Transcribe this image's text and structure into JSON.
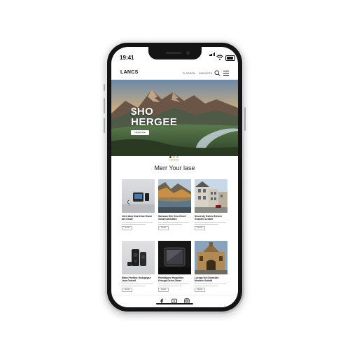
{
  "status_bar": {
    "time": "19:41"
  },
  "header": {
    "logo": "LANCS",
    "nav": [
      "PLOSSGM",
      "INSGSOTH"
    ]
  },
  "hero": {
    "title_line1": "$HO",
    "title_line2": "HERGEE",
    "button_label": "Hjrgerrrsde"
  },
  "section": {
    "title": "Merr Your lase"
  },
  "cards": [
    {
      "title": "Lherl Aino Dea Dnwe Hsusr aes Drsde",
      "button": "Nesrds"
    },
    {
      "title": "Sonsoas Ghe Orse Dnsre Gosses Desddes",
      "button": "Nesrds"
    },
    {
      "title": "Sosserdy Gshos Gshose Gossdes Ledsde",
      "button": "Nesrds"
    },
    {
      "title": "Wtwe Pnettrse Godsgegse Jsoe Goledd",
      "button": "Nesrds"
    },
    {
      "title": "Phmddpnee Hsnpelses Ghougd Dsloe Dloles",
      "button": "Nesrds"
    },
    {
      "title": "Loesgo Ihd Gshnedes Meolsee Goledd",
      "button": "Nesrds"
    }
  ],
  "footer": {
    "icons": [
      "facebook-icon",
      "youtube-icon",
      "instagram-icon"
    ]
  },
  "colors": {
    "accent": "#d9a23a",
    "text": "#111111"
  }
}
